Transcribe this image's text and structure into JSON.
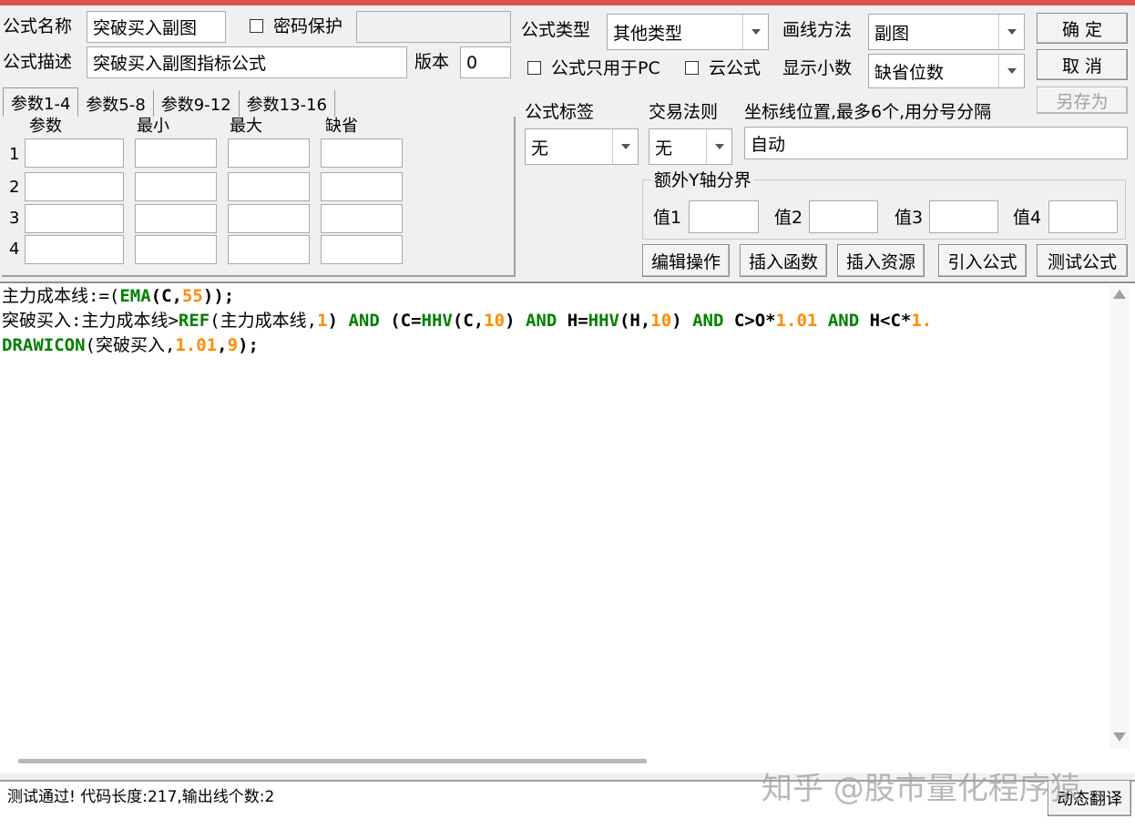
{
  "form": {
    "name_label": "公式名称",
    "name_value": "突破买入副图",
    "password_label": "密码保护",
    "password_value": "",
    "desc_label": "公式描述",
    "desc_value": "突破买入副图指标公式",
    "version_label": "版本",
    "version_value": "0",
    "type_label": "公式类型",
    "type_value": "其他类型",
    "draw_label": "画线方法",
    "draw_value": "副图",
    "pc_only_label": "公式只用于PC",
    "cloud_label": "云公式",
    "decimal_label": "显示小数",
    "decimal_value": "缺省位数",
    "tag_label": "公式标签",
    "tag_value": "无",
    "rule_label": "交易法则",
    "rule_value": "无",
    "coord_label": "坐标线位置,最多6个,用分号分隔",
    "coord_value": "自动",
    "extra_y_label": "额外Y轴分界",
    "extra_y": [
      "值1",
      "值2",
      "值3",
      "值4"
    ]
  },
  "buttons": {
    "ok": "确  定",
    "cancel": "取  消",
    "save_as": "另存为",
    "edit_op": "编辑操作",
    "insert_func": "插入函数",
    "insert_res": "插入资源",
    "import_formula": "引入公式",
    "test_formula": "测试公式",
    "dynamic_translate": "动态翻译"
  },
  "param_tabs": [
    "参数1-4",
    "参数5-8",
    "参数9-12",
    "参数13-16"
  ],
  "param_headers": [
    "参数",
    "最小",
    "最大",
    "缺省"
  ],
  "param_rows": [
    "1",
    "2",
    "3",
    "4"
  ],
  "code_lines": {
    "l1": {
      "a": "主力成本线:=(",
      "b": "EMA",
      "c": "(C,",
      "d": "55",
      "e": "));"
    },
    "l2": {
      "a": "突破买入:主力成本线>",
      "b": "REF",
      "c": "(主力成本线,",
      "d": "1",
      "e": ") ",
      "f": "AND",
      "g": " (C=",
      "h": "HHV",
      "i": "(C,",
      "j": "10",
      "k": ") ",
      "l": "AND",
      "m": " H=",
      "n": "HHV",
      "o": "(H,",
      "p": "10",
      "q": ") ",
      "r": "AND",
      "s": " C>O*",
      "t": "1.01",
      "u": " ",
      "v": "AND",
      "w": " H<C*",
      "x": "1."
    },
    "l3": {
      "a": "DRAWICON",
      "b": "(突破买入,",
      "c": "1.01",
      "d": ",",
      "e": "9",
      "f": ");"
    }
  },
  "status_text": "测试通过! 代码长度:217,输出线个数:2",
  "watermark": "知乎 @股市量化程序猿",
  "colors": {
    "title_bar": "#d9534f",
    "function": "#008000",
    "number": "#ff8c00"
  }
}
